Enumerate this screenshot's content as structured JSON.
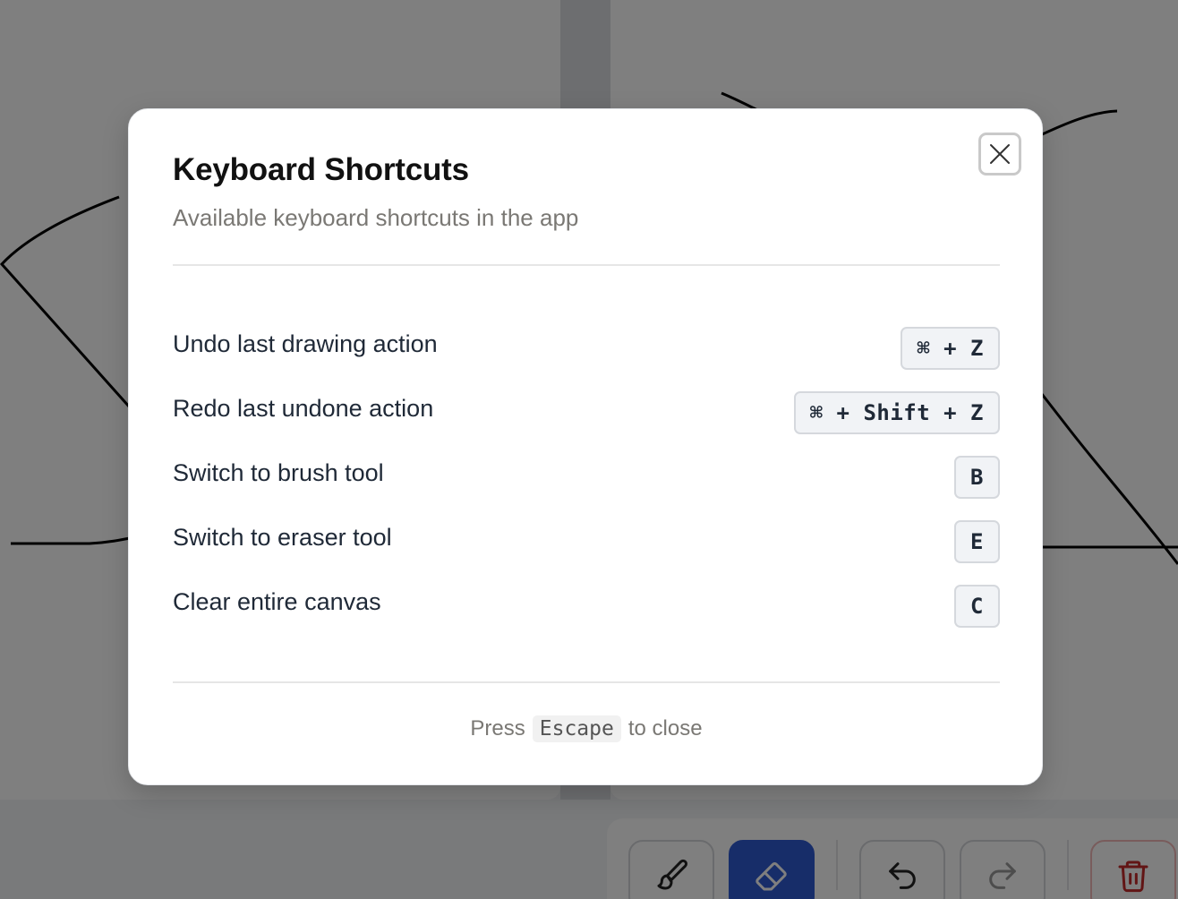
{
  "modal": {
    "title": "Keyboard Shortcuts",
    "subtitle": "Available keyboard shortcuts in the app",
    "close_icon": "close-icon",
    "shortcuts": [
      {
        "label": "Undo last drawing action",
        "keys": "⌘ + Z"
      },
      {
        "label": "Redo last undone action",
        "keys": "⌘ + Shift + Z"
      },
      {
        "label": "Switch to brush tool",
        "keys": "B"
      },
      {
        "label": "Switch to eraser tool",
        "keys": "E"
      },
      {
        "label": "Clear entire canvas",
        "keys": "C"
      }
    ],
    "footer": {
      "prefix": "Press",
      "key": "Escape",
      "suffix": "to close"
    }
  },
  "toolbar": {
    "tools": [
      {
        "icon": "brush-icon",
        "active": false
      },
      {
        "icon": "eraser-icon",
        "active": true
      },
      {
        "icon": "undo-icon",
        "active": false
      },
      {
        "icon": "redo-icon",
        "active": false
      },
      {
        "icon": "trash-icon",
        "active": false
      }
    ]
  },
  "colors": {
    "accent": "#2f5bd3",
    "danger": "#c42b2b",
    "overlay": "rgba(0,0,0,0.5)"
  }
}
